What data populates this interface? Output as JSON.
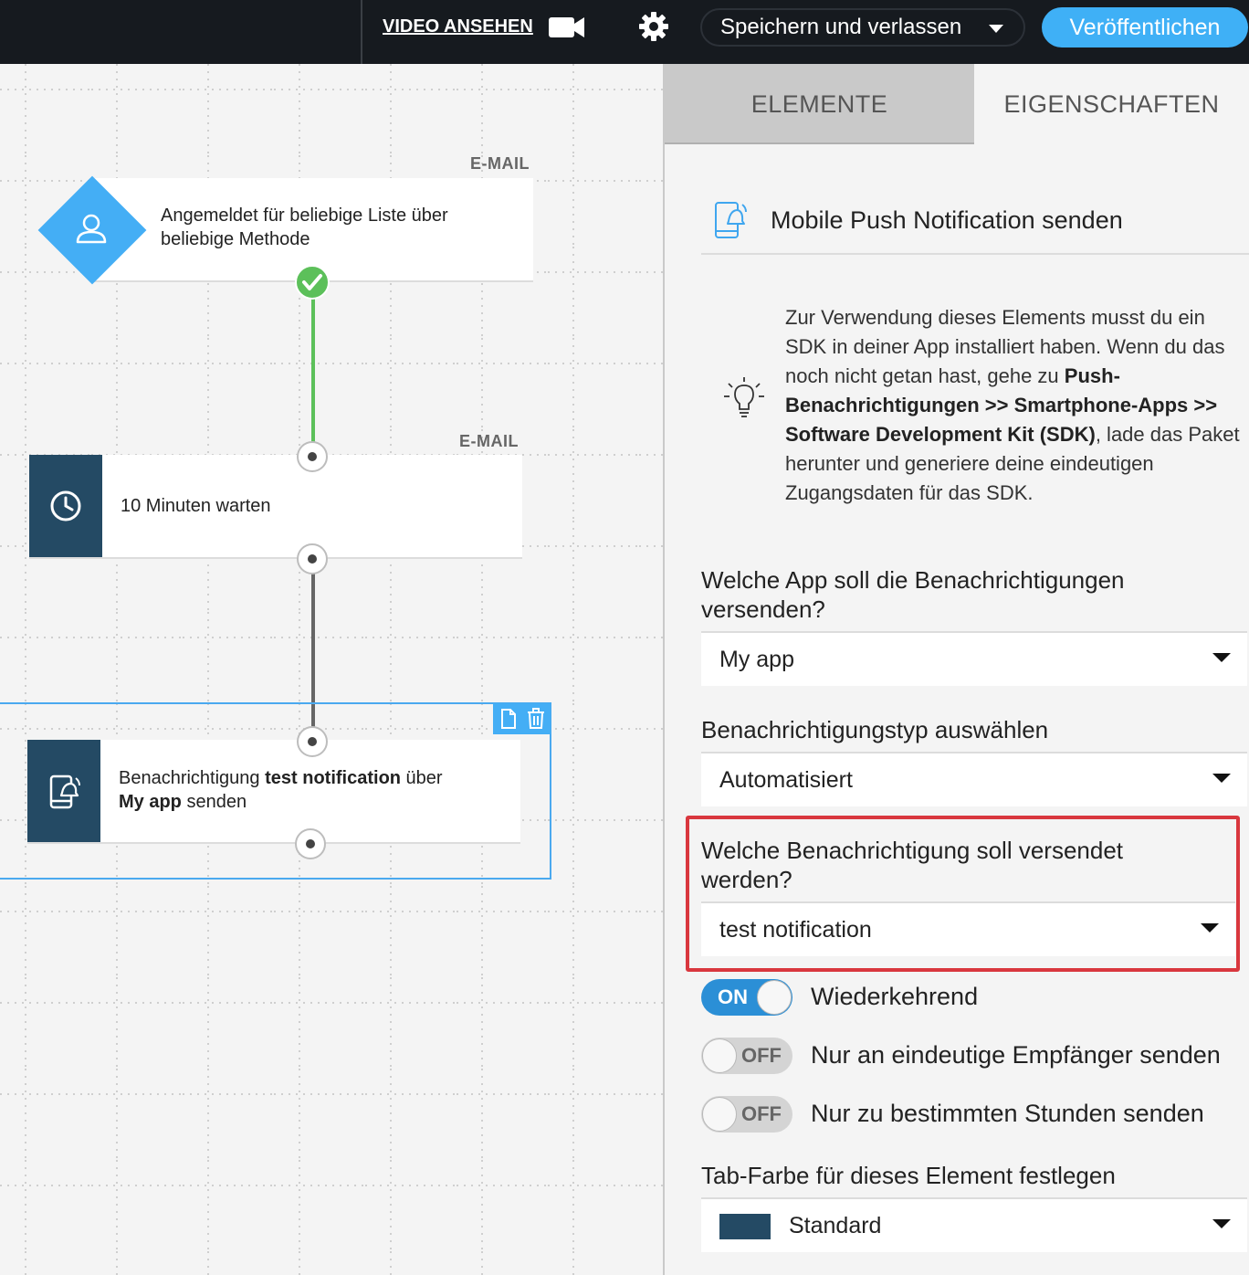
{
  "topbar": {
    "video_link": "VIDEO ANSEHEN",
    "save_label": "Speichern und verlassen",
    "publish_label": "Veröffentlichen"
  },
  "canvas": {
    "node1": {
      "channel": "E-MAIL",
      "text": "Angemeldet für beliebige Liste über beliebige Methode",
      "icon": "user-icon"
    },
    "node2": {
      "channel": "E-MAIL",
      "text": "10 Minuten warten",
      "icon": "clock-icon"
    },
    "node3": {
      "text_part1": "Benachrichtigung ",
      "text_bold1": "test notification",
      "text_part2": " über",
      "text_bold2": "My app",
      "text_part3": " senden",
      "icon": "mobile-notification-icon"
    }
  },
  "panel": {
    "tabs": [
      "ELEMENTE",
      "EIGENSCHAFTEN"
    ],
    "title": "Mobile Push Notification senden",
    "info": {
      "part1": "Zur Verwendung dieses Elements musst du ein SDK in deiner App installiert haben. Wenn du das noch nicht getan hast, gehe zu ",
      "bold": "Push-Benachrichtigungen >> Smartphone-Apps >> Software Development Kit (SDK)",
      "part2": ", lade das Paket herunter und generiere deine eindeutigen Zugangsdaten für das SDK."
    },
    "app_question": "Welche App soll die Benachrichtigungen versenden?",
    "app_value": "My app",
    "type_label": "Benachrichtigungstyp auswählen",
    "type_value": "Automatisiert",
    "notification_question": "Welche Benachrichtigung soll versendet werden?",
    "notification_value": "test notification",
    "toggles": [
      {
        "state": "ON",
        "label": "Wiederkehrend"
      },
      {
        "state": "OFF",
        "label": "Nur an eindeutige Empfänger senden"
      },
      {
        "state": "OFF",
        "label": "Nur zu bestimmten Stunden senden"
      }
    ],
    "tab_color_label": "Tab-Farbe für dieses Element festlegen",
    "tab_color_value": "Standard"
  },
  "colors": {
    "accent_blue": "#3fb0f6",
    "node_dark": "#244a64",
    "success_green": "#5cc05a",
    "highlight_red": "#d9373e"
  }
}
